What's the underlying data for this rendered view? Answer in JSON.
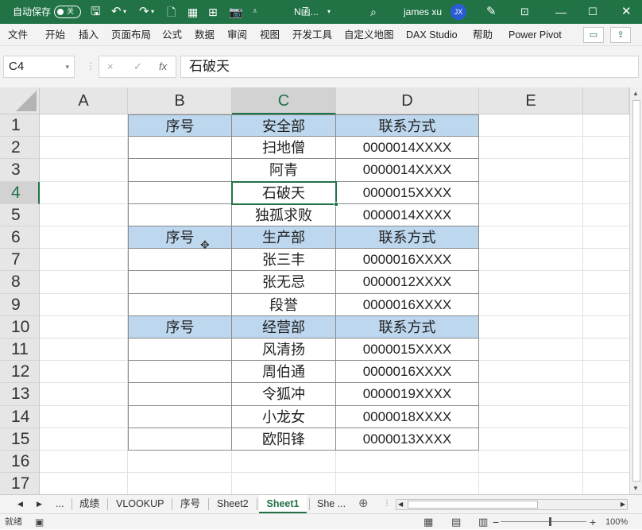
{
  "titlebar": {
    "autosave_label": "自动保存",
    "autosave_state": "关",
    "filename": "N函...",
    "username": "james xu",
    "avatar_initials": "JX"
  },
  "ribbon": {
    "tabs": [
      "文件",
      "开始",
      "插入",
      "页面布局",
      "公式",
      "数据",
      "审阅",
      "视图",
      "开发工具",
      "自定义地图",
      "DAX Studio",
      "帮助",
      "Power Pivot"
    ]
  },
  "formula_bar": {
    "name_box": "C4",
    "cancel": "×",
    "enter": "✓",
    "fx": "fx",
    "content": "石破天"
  },
  "columns": [
    "A",
    "B",
    "C",
    "D",
    "E"
  ],
  "rows": [
    "1",
    "2",
    "3",
    "4",
    "5",
    "6",
    "7",
    "8",
    "9",
    "10",
    "11",
    "12",
    "13",
    "14",
    "15",
    "16",
    "17"
  ],
  "table": {
    "rows": [
      [
        "序号",
        "安全部",
        "联系方式"
      ],
      [
        "",
        "扫地僧",
        "0000014XXXX"
      ],
      [
        "",
        "阿青",
        "0000014XXXX"
      ],
      [
        "",
        "石破天",
        "0000015XXXX"
      ],
      [
        "",
        "独孤求败",
        "0000014XXXX"
      ],
      [
        "序号",
        "生产部",
        "联系方式"
      ],
      [
        "",
        "张三丰",
        "0000016XXXX"
      ],
      [
        "",
        "张无忌",
        "0000012XXXX"
      ],
      [
        "",
        "段誉",
        "0000016XXXX"
      ],
      [
        "序号",
        "经营部",
        "联系方式"
      ],
      [
        "",
        "风清扬",
        "0000015XXXX"
      ],
      [
        "",
        "周伯通",
        "0000016XXXX"
      ],
      [
        "",
        "令狐冲",
        "0000019XXXX"
      ],
      [
        "",
        "小龙女",
        "0000018XXXX"
      ],
      [
        "",
        "欧阳锋",
        "0000013XXXX"
      ]
    ],
    "header_rows": [
      0,
      5,
      9
    ]
  },
  "sheet_tabs": {
    "ellipsis": "...",
    "tabs": [
      "成绩",
      "VLOOKUP",
      "序号",
      "Sheet2",
      "Sheet1",
      "She ..."
    ],
    "active": "Sheet1"
  },
  "status": {
    "ready": "就绪",
    "zoom": "100%"
  },
  "colors": {
    "excel_green": "#217346",
    "header_fill": "#bdd7ee"
  }
}
